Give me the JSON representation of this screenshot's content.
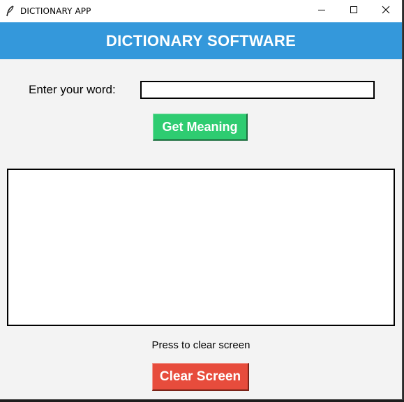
{
  "window": {
    "title": "DICTIONARY APP",
    "icon": "feather-icon",
    "controls": {
      "minimize_icon": "minimize-icon",
      "maximize_icon": "maximize-icon",
      "close_icon": "close-icon"
    }
  },
  "header": {
    "title": "DICTIONARY SOFTWARE",
    "background": "#3498db"
  },
  "form": {
    "label": "Enter your word:",
    "input_value": "",
    "button_label": "Get Meaning",
    "button_color": "#2ecc71"
  },
  "result": {
    "text": ""
  },
  "footer": {
    "clear_label": "Press to clear screen",
    "clear_button_label": "Clear Screen",
    "clear_button_color": "#e74c3c"
  }
}
